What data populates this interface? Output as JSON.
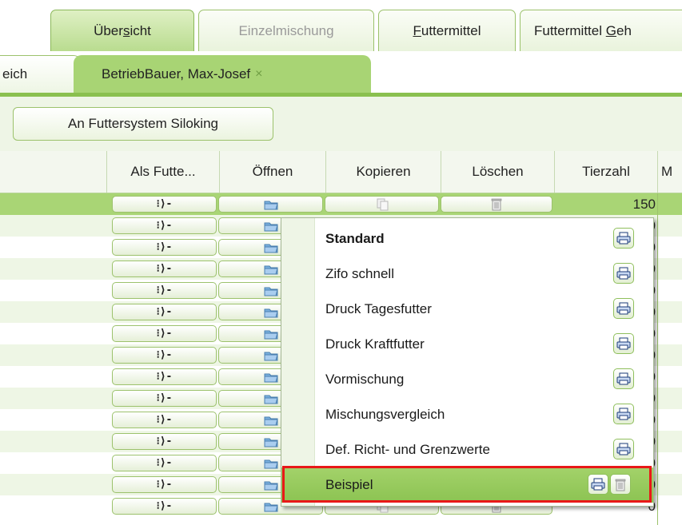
{
  "tabs_main": [
    {
      "pre": "Über",
      "u": "s",
      "post": "icht",
      "state": "active"
    },
    {
      "pre": "",
      "u": "",
      "post": "Einzelmischung",
      "state": "disabled"
    },
    {
      "pre": "",
      "u": "F",
      "post": "uttermittel",
      "state": "normal"
    },
    {
      "pre": "Futtermittel ",
      "u": "G",
      "post": "eh",
      "state": "normal"
    }
  ],
  "tabs_sub": {
    "inactive_label": "eich",
    "active_label": "BetriebBauer, Max-Josef",
    "close_glyph": "×"
  },
  "toolbar": {
    "system_button": "An Futtersystem Siloking"
  },
  "columns": [
    "Als Futte...",
    "Öffnen",
    "Kopieren",
    "Löschen",
    "Tierzahl",
    "M"
  ],
  "rows": {
    "als_glyph": "⁝⟩-",
    "first_tierzahl": "150",
    "last_tierzahl": "0",
    "partial_digit": "0"
  },
  "popup": {
    "items": [
      {
        "label": "Standard",
        "bold": true
      },
      {
        "label": "Zifo schnell",
        "bold": false
      },
      {
        "label": "Druck Tagesfutter",
        "bold": false
      },
      {
        "label": "Druck Kraftfutter",
        "bold": false
      },
      {
        "label": "Vormischung",
        "bold": false
      },
      {
        "label": "Mischungsvergleich",
        "bold": false
      },
      {
        "label": "Def. Richt- und Grenzwerte",
        "bold": false
      },
      {
        "label": "Beispiel",
        "bold": false,
        "highlighted": true,
        "deletable": true
      }
    ]
  },
  "colors": {
    "accent": "#8ac04f",
    "selected_row": "#a9d575",
    "highlight_border": "#e81818"
  }
}
